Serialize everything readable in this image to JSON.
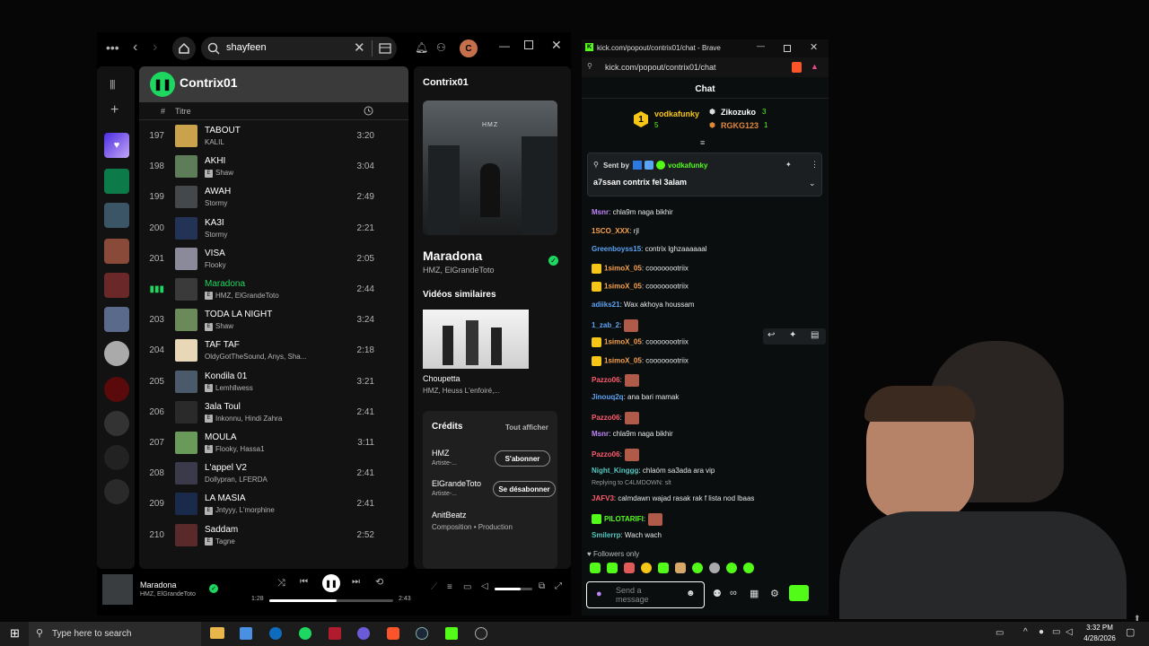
{
  "colors": {
    "spotify_green": "#1ed760",
    "kick_green": "#53fc18",
    "bg": "#121212"
  },
  "spotify": {
    "search": {
      "value": "shayfeen"
    },
    "account_initial": "C",
    "playlist": {
      "name": "Contrix01",
      "col_number": "#",
      "col_title": "Titre"
    },
    "tracks": [
      {
        "num": "197",
        "title": "TABOUT",
        "artist": "KALIL",
        "duration": "3:20",
        "explicit": false,
        "playing": false
      },
      {
        "num": "198",
        "title": "AKHI",
        "artist": "Shaw",
        "duration": "3:04",
        "explicit": true,
        "playing": false
      },
      {
        "num": "199",
        "title": "AWAH",
        "artist": "Stormy",
        "duration": "2:49",
        "explicit": false,
        "playing": false
      },
      {
        "num": "200",
        "title": "KA3I",
        "artist": "Stormy",
        "duration": "2:21",
        "explicit": false,
        "playing": false
      },
      {
        "num": "201",
        "title": "VISA",
        "artist": "Flooky",
        "duration": "2:05",
        "explicit": false,
        "playing": false
      },
      {
        "num": "",
        "title": "Maradona",
        "artist": "HMZ, ElGrandeToto",
        "duration": "2:44",
        "explicit": true,
        "playing": true
      },
      {
        "num": "203",
        "title": "TODA LA NIGHT",
        "artist": "Shaw",
        "duration": "3:24",
        "explicit": true,
        "playing": false
      },
      {
        "num": "204",
        "title": "TAF TAF",
        "artist": "OldyGotTheSound, Anys, Sha...",
        "duration": "2:18",
        "explicit": false,
        "playing": false
      },
      {
        "num": "205",
        "title": "Kondila 01",
        "artist": "Lemhllwess",
        "duration": "3:21",
        "explicit": true,
        "playing": false
      },
      {
        "num": "206",
        "title": "3ala Toul",
        "artist": "Inkonnu, Hindi Zahra",
        "duration": "2:41",
        "explicit": true,
        "playing": false
      },
      {
        "num": "207",
        "title": "MOULA",
        "artist": "Flooky, Hassa1",
        "duration": "3:11",
        "explicit": true,
        "playing": false
      },
      {
        "num": "208",
        "title": "L'appel V2",
        "artist": "Dollypran, LFERDA",
        "duration": "2:41",
        "explicit": false,
        "playing": false
      },
      {
        "num": "209",
        "title": "LA MASIA",
        "artist": "Jntyyy, L'morphine",
        "duration": "2:41",
        "explicit": true,
        "playing": false
      },
      {
        "num": "210",
        "title": "Saddam",
        "artist": "Tagne",
        "duration": "2:52",
        "explicit": true,
        "playing": false
      }
    ],
    "right_panel": {
      "header": "Contrix01",
      "album_text": "HMZ",
      "track_title": "Maradona",
      "track_artists": "HMZ, ElGrandeToto",
      "similar_heading": "Vidéos similaires",
      "similar_title": "Choupetta",
      "similar_artists": "HMZ, Heuss L'enfoiré,...",
      "credits_heading": "Crédits",
      "credits_show_all": "Tout afficher",
      "credits": [
        {
          "name": "HMZ",
          "role": "Artiste-...",
          "action": "S'abonner"
        },
        {
          "name": "ElGrandeToto",
          "role": "Artiste-...",
          "action": "Se désabonner"
        },
        {
          "name": "AnitBeatz",
          "role": "Composition • Production",
          "action": ""
        }
      ]
    },
    "player": {
      "title": "Maradona",
      "artists": "HMZ, ElGrandeToto",
      "elapsed": "1:28",
      "total": "2:43",
      "progress": 0.54,
      "volume": 0.7
    }
  },
  "kick": {
    "window_title": "kick.com/popout/contrix01/chat - Brave",
    "url": "kick.com/popout/contrix01/chat",
    "chat_title": "Chat",
    "top_gifters": [
      {
        "name": "vodkafunky",
        "count": "5"
      },
      {
        "name": "Zikozuko",
        "count": "3"
      },
      {
        "name": "RGKG123",
        "count": "1"
      }
    ],
    "pinned": {
      "sent_by": "Sent by",
      "user": "vodkafunky",
      "text": "a7ssan contrix fel 3alam"
    },
    "messages": [
      {
        "user": "Msnr",
        "color": "#c084fc",
        "text": ": chla9m naga bikhir"
      },
      {
        "user": "1SCO_XXX",
        "color": "#f7a24f",
        "text": ": rjl"
      },
      {
        "user": "Greenboyss15",
        "color": "#5ba4f5",
        "text": ": contrix lghzaaaaaal"
      },
      {
        "user": "1simoX_05",
        "color": "#f7a24f",
        "text": ": coooooootriix"
      },
      {
        "user": "1simoX_05",
        "color": "#f7a24f",
        "text": ": coooooootriix"
      },
      {
        "user": "adiiks21",
        "color": "#5ba4f5",
        "text": ": Wax akhoya houssam"
      },
      {
        "user": "1_zab_2",
        "color": "#5ba4f5",
        "text": ":"
      },
      {
        "user": "1simoX_05",
        "color": "#f7a24f",
        "text": ": coooooootriix"
      },
      {
        "user": "1simoX_05",
        "color": "#f7a24f",
        "text": ": coooooootriix"
      },
      {
        "user": "Pazzo06",
        "color": "#ff5b6e",
        "text": ":"
      },
      {
        "user": "Jinouq2q",
        "color": "#5ba4f5",
        "text": ": ana bari mamak"
      },
      {
        "user": "Pazzo06",
        "color": "#ff5b6e",
        "text": ":"
      },
      {
        "user": "Msnr",
        "color": "#c084fc",
        "text": ": chla9m naga bikhir"
      },
      {
        "user": "Pazzo06",
        "color": "#ff5b6e",
        "text": ":"
      },
      {
        "user": "Night_Kinggg",
        "color": "#53c7c0",
        "text": ": chlaóm sa3ada ara vip"
      },
      {
        "user": "JAFV3",
        "color": "#ff5b6e",
        "text": ": calmdawn wajad rasak rak f lista nod lbaas"
      },
      {
        "user": "PILOTARIFI",
        "color": "#53fc18",
        "text": ":"
      },
      {
        "user": "Smilerrp",
        "color": "#53c7c0",
        "text": ": Wach wach"
      }
    ],
    "reply_note": "Replying to C4LMDOWN: slt",
    "followers_only": "Followers only",
    "send_placeholder": "Send a message"
  },
  "taskbar": {
    "search_placeholder": "Type here to search",
    "time": "3:32 PM",
    "date": "4/28/2026"
  }
}
